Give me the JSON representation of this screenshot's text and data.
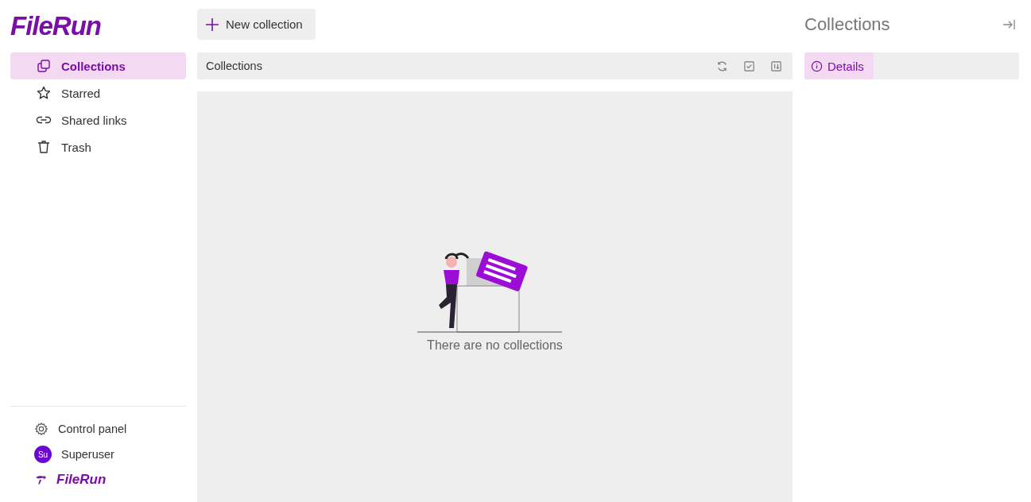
{
  "logo": "FileRun",
  "sidebar": {
    "items": [
      {
        "label": "Collections",
        "kind": "collections",
        "selected": true
      },
      {
        "label": "Starred",
        "kind": "star",
        "selected": false
      },
      {
        "label": "Shared links",
        "kind": "link",
        "selected": false
      },
      {
        "label": "Trash",
        "kind": "trash",
        "selected": false
      }
    ],
    "footer": [
      {
        "kind": "settings",
        "label": "Control panel"
      },
      {
        "kind": "user",
        "avatar": "Su",
        "label": "Superuser"
      },
      {
        "kind": "brand",
        "label": "FileRun"
      }
    ]
  },
  "toolbar": {
    "new_button": "New collection"
  },
  "breadcrumb": "Collections",
  "empty_state": "There are no collections",
  "details_panel": {
    "title": "Collections",
    "tabs": [
      {
        "label": "Details",
        "selected": true
      }
    ]
  }
}
